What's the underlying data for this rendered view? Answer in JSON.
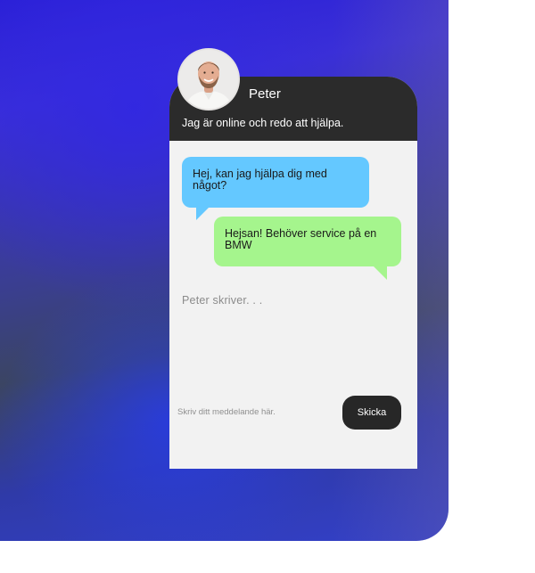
{
  "chat": {
    "agent_name": "Peter",
    "agent_status": "Jag är online och redo att hjälpa.",
    "messages": [
      {
        "from": "agent",
        "text": "Hej, kan jag hjälpa dig med något?"
      },
      {
        "from": "user",
        "text": "Hejsan! Behöver service på en BMW"
      }
    ],
    "typing_indicator": "Peter skriver. . .",
    "input_placeholder": "Skriv ditt meddelande här.",
    "input_value": "",
    "send_label": "Skicka"
  },
  "colors": {
    "header_bg": "#2b2b2b",
    "body_bg": "#f2f2f2",
    "agent_bubble": "#64c8ff",
    "user_bubble": "#a5f58d",
    "send_button": "#272727",
    "backdrop_accent": "#3a2fd8"
  },
  "icons": {
    "avatar": "agent-avatar-photo"
  }
}
